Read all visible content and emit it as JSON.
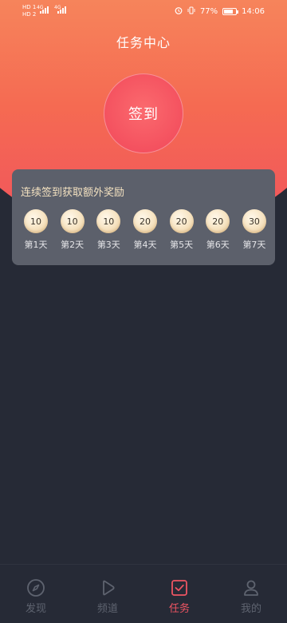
{
  "status_bar": {
    "time": "14:06",
    "battery": "77%",
    "net_top": "HD 1",
    "net_bottom": "HD 2",
    "gen1": "4G",
    "gen2": "4G"
  },
  "header": {
    "title": "任务中心"
  },
  "checkin": {
    "label": "签到"
  },
  "reward_card": {
    "title": "连续签到获取额外奖励",
    "days": [
      {
        "value": "10",
        "label": "第1天"
      },
      {
        "value": "10",
        "label": "第2天"
      },
      {
        "value": "10",
        "label": "第3天"
      },
      {
        "value": "20",
        "label": "第4天"
      },
      {
        "value": "20",
        "label": "第5天"
      },
      {
        "value": "20",
        "label": "第6天"
      },
      {
        "value": "30",
        "label": "第7天"
      }
    ]
  },
  "tabbar": {
    "items": [
      {
        "label": "发现",
        "icon": "compass-icon",
        "active": false
      },
      {
        "label": "频道",
        "icon": "play-icon",
        "active": false
      },
      {
        "label": "任务",
        "icon": "task-check-icon",
        "active": true
      },
      {
        "label": "我的",
        "icon": "user-icon",
        "active": false
      }
    ]
  },
  "colors": {
    "accent": "#ef5563",
    "background": "#262a36",
    "card": "#5c606b",
    "coin": "#f6e3c1"
  }
}
